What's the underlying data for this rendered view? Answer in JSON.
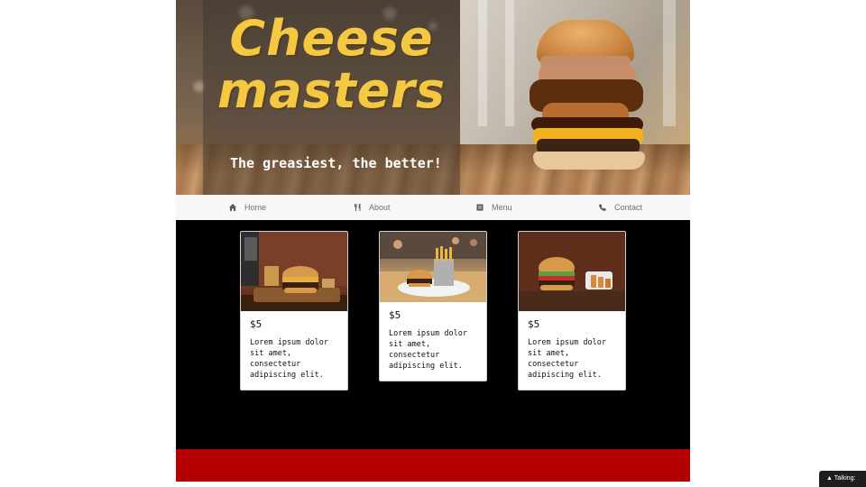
{
  "hero": {
    "title_line1": "Cheese",
    "title_line2": "masters",
    "tagline": "The greasiest, the better!"
  },
  "nav": {
    "items": [
      {
        "label": "Home",
        "icon": "home-icon"
      },
      {
        "label": "About",
        "icon": "utensils-icon"
      },
      {
        "label": "Menu",
        "icon": "menu-book-icon"
      },
      {
        "label": "Contact",
        "icon": "phone-icon"
      }
    ]
  },
  "cards": [
    {
      "price": "$5",
      "description": "Lorem ipsum dolor sit amet, consectetur adipiscing elit."
    },
    {
      "price": "$5",
      "description": "Lorem ipsum dolor sit amet, consectetur adipiscing elit."
    },
    {
      "price": "$5",
      "description": "Lorem ipsum dolor sit amet, consectetur adipiscing elit."
    }
  ],
  "widget": {
    "talking_label": "▲ Talking:"
  },
  "colors": {
    "title": "#f5c842",
    "footer": "#b30000",
    "main_bg": "#000000",
    "nav_bg": "#f7f7f8"
  }
}
